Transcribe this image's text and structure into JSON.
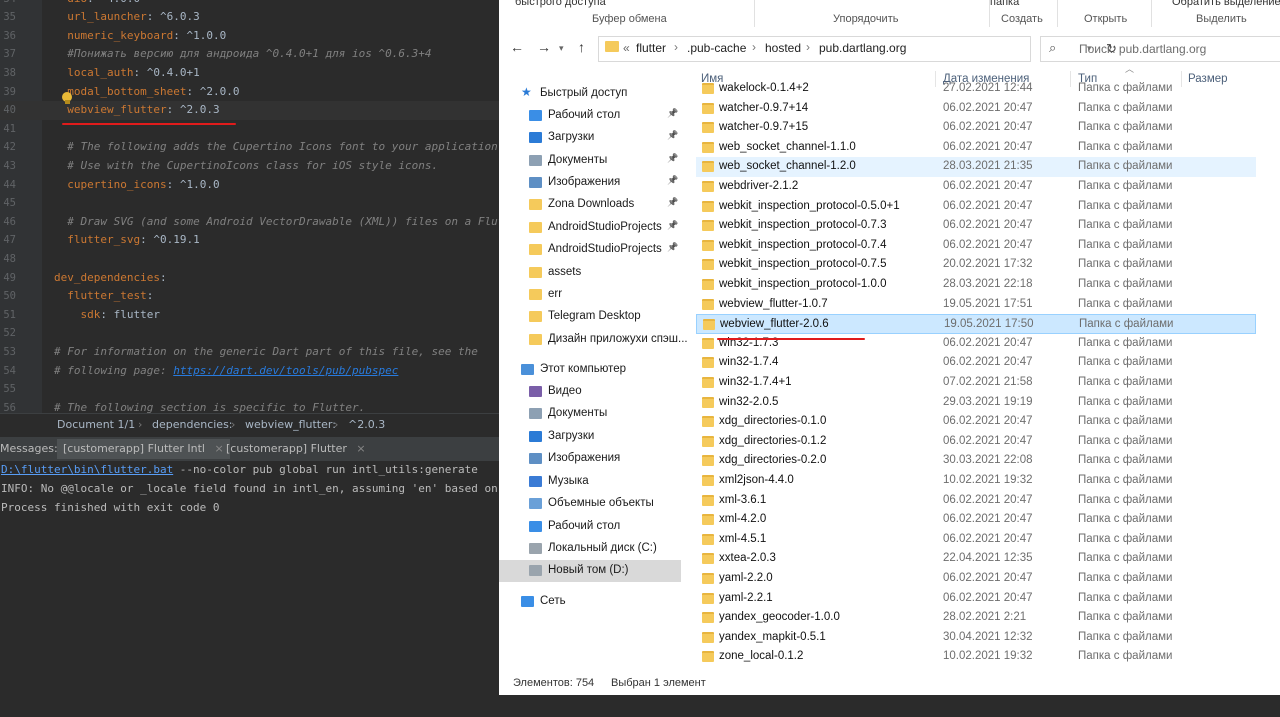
{
  "ide": {
    "editor_lines": [
      {
        "num": "34",
        "key": "dio",
        "val": "^4.0.0",
        "indent": "  "
      },
      {
        "num": "35",
        "key": "url_launcher",
        "val": "^6.0.3",
        "indent": "  "
      },
      {
        "num": "36",
        "key": "numeric_keyboard",
        "val": "^1.0.0",
        "indent": "  "
      },
      {
        "num": "37",
        "comment": "  #Понижать версию для андроида ^0.4.0+1 для ios ^0.6.3+4"
      },
      {
        "num": "38",
        "key": "local_auth",
        "val": "^0.4.0+1",
        "indent": "  "
      },
      {
        "num": "39",
        "key": "modal_bottom_sheet",
        "val": "^2.0.0",
        "indent": "  "
      },
      {
        "num": "40",
        "key": "webview_flutter",
        "val": "^2.0.3",
        "indent": "  "
      },
      {
        "num": "41",
        "comment": ""
      },
      {
        "num": "42",
        "comment": "  # The following adds the Cupertino Icons font to your application."
      },
      {
        "num": "43",
        "comment": "  # Use with the CupertinoIcons class for iOS style icons."
      },
      {
        "num": "44",
        "key": "cupertino_icons",
        "val": "^1.0.0",
        "indent": "  "
      },
      {
        "num": "45",
        "comment": ""
      },
      {
        "num": "46",
        "comment": "  # Draw SVG (and some Android VectorDrawable (XML)) files on a Flut"
      },
      {
        "num": "47",
        "key": "flutter_svg",
        "val": "^0.19.1",
        "indent": "  "
      },
      {
        "num": "48",
        "comment": ""
      },
      {
        "num": "49",
        "key": "dev_dependencies",
        "val": "",
        "indent": ""
      },
      {
        "num": "50",
        "key": "flutter_test",
        "val": "",
        "indent": "  "
      },
      {
        "num": "51",
        "key": "sdk",
        "val": "flutter",
        "indent": "    "
      },
      {
        "num": "52",
        "comment": ""
      },
      {
        "num": "53",
        "comment": "# For information on the generic Dart part of this file, see the"
      },
      {
        "num": "54",
        "comment": "# following page: ",
        "link": "https://dart.dev/tools/pub/pubspec"
      },
      {
        "num": "55",
        "comment": ""
      },
      {
        "num": "56",
        "comment": "# The following section is specific to Flutter."
      }
    ],
    "breadcrumb": {
      "doc": "Document 1/1",
      "sep": "›",
      "dependencies": "dependencies:",
      "webview": "webview_flutter:",
      "version": "^2.0.3"
    },
    "messages": {
      "label": "Messages:",
      "tab1": "[customerapp] Flutter Intl",
      "tab2": "[customerapp] Flutter",
      "close": "×"
    },
    "console": {
      "line1_link": "D:\\flutter\\bin\\flutter.bat",
      "line1_rest": " --no-color pub global run intl_utils:generate",
      "line2": "INFO: No @@locale or _locale field found in intl_en, assuming 'en' based on",
      "line3": "Process finished with exit code 0"
    }
  },
  "explorer": {
    "ribbon": {
      "quick_access": "быстрого доступа",
      "clipboard": "Буфер обмена",
      "organize": "Упорядочить",
      "folder": "папка",
      "create": "Создать",
      "open": "Открыть",
      "select": "Выделить",
      "select_top": "Обратить выделение"
    },
    "address": {
      "back": "←",
      "forward": "→",
      "up": "↑",
      "prefix": "«",
      "segments": [
        "flutter",
        ".pub-cache",
        "hosted",
        "pub.dartlang.org"
      ],
      "refresh": "↻",
      "search_placeholder": "Поиск: pub.dartlang.org"
    },
    "columns": {
      "name": "Имя",
      "date": "Дата изменения",
      "type": "Тип",
      "size": "Размер"
    },
    "nav": [
      {
        "label": "Быстрый доступ",
        "icon": "star-icon",
        "color": "#2b7bd6",
        "indent": 0,
        "pin": false
      },
      {
        "label": "Рабочий стол",
        "icon": "desktop-icon",
        "color": "#3a8ee6",
        "indent": 1,
        "pin": true
      },
      {
        "label": "Загрузки",
        "icon": "download-icon",
        "color": "#2b7bd6",
        "indent": 1,
        "pin": true
      },
      {
        "label": "Документы",
        "icon": "documents-icon",
        "color": "#8da0b3",
        "indent": 1,
        "pin": true
      },
      {
        "label": "Изображения",
        "icon": "pictures-icon",
        "color": "#5e8fc4",
        "indent": 1,
        "pin": true
      },
      {
        "label": "Zona Downloads",
        "icon": "folder-icon",
        "color": "#f5ca5b",
        "indent": 1,
        "pin": true
      },
      {
        "label": "AndroidStudioProjects",
        "icon": "folder-icon",
        "color": "#f5ca5b",
        "indent": 1,
        "pin": true
      },
      {
        "label": "AndroidStudioProjects",
        "icon": "folder-icon",
        "color": "#f5ca5b",
        "indent": 1,
        "pin": true
      },
      {
        "label": "assets",
        "icon": "folder-icon",
        "color": "#f5ca5b",
        "indent": 1,
        "pin": false
      },
      {
        "label": "err",
        "icon": "folder-icon",
        "color": "#f5ca5b",
        "indent": 1,
        "pin": false
      },
      {
        "label": "Telegram Desktop",
        "icon": "folder-icon",
        "color": "#f5ca5b",
        "indent": 1,
        "pin": false
      },
      {
        "label": "Дизайн приложухи спэш...",
        "icon": "folder-icon",
        "color": "#f5ca5b",
        "indent": 1,
        "pin": false
      },
      {
        "label": "Этот компьютер",
        "icon": "computer-icon",
        "color": "#4a90d9",
        "indent": 0,
        "pin": false
      },
      {
        "label": "Видео",
        "icon": "video-icon",
        "color": "#7a5ea8",
        "indent": 1,
        "pin": false
      },
      {
        "label": "Документы",
        "icon": "documents-icon",
        "color": "#8da0b3",
        "indent": 1,
        "pin": false
      },
      {
        "label": "Загрузки",
        "icon": "download-icon",
        "color": "#2b7bd6",
        "indent": 1,
        "pin": false
      },
      {
        "label": "Изображения",
        "icon": "pictures-icon",
        "color": "#5e8fc4",
        "indent": 1,
        "pin": false
      },
      {
        "label": "Музыка",
        "icon": "music-icon",
        "color": "#3a7bd5",
        "indent": 1,
        "pin": false
      },
      {
        "label": "Объемные объекты",
        "icon": "3d-objects-icon",
        "color": "#6aa0d8",
        "indent": 1,
        "pin": false
      },
      {
        "label": "Рабочий стол",
        "icon": "desktop-icon",
        "color": "#3a8ee6",
        "indent": 1,
        "pin": false
      },
      {
        "label": "Локальный диск (C:)",
        "icon": "drive-icon",
        "color": "#9aa4ad",
        "indent": 1,
        "pin": false
      },
      {
        "label": "Новый том (D:)",
        "icon": "drive-icon",
        "color": "#9aa4ad",
        "indent": 1,
        "pin": false,
        "selected": true
      },
      {
        "label": "Сеть",
        "icon": "network-icon",
        "color": "#3a8ee6",
        "indent": 0,
        "pin": false
      }
    ],
    "files": [
      {
        "name": "wakelock-0.1.4+2",
        "date": "27.02.2021 12:44",
        "type": "Папка с файлами"
      },
      {
        "name": "watcher-0.9.7+14",
        "date": "06.02.2021 20:47",
        "type": "Папка с файлами"
      },
      {
        "name": "watcher-0.9.7+15",
        "date": "06.02.2021 20:47",
        "type": "Папка с файлами"
      },
      {
        "name": "web_socket_channel-1.1.0",
        "date": "06.02.2021 20:47",
        "type": "Папка с файлами"
      },
      {
        "name": "web_socket_channel-1.2.0",
        "date": "28.03.2021 21:35",
        "type": "Папка с файлами",
        "state": "hover"
      },
      {
        "name": "webdriver-2.1.2",
        "date": "06.02.2021 20:47",
        "type": "Папка с файлами"
      },
      {
        "name": "webkit_inspection_protocol-0.5.0+1",
        "date": "06.02.2021 20:47",
        "type": "Папка с файлами"
      },
      {
        "name": "webkit_inspection_protocol-0.7.3",
        "date": "06.02.2021 20:47",
        "type": "Папка с файлами"
      },
      {
        "name": "webkit_inspection_protocol-0.7.4",
        "date": "06.02.2021 20:47",
        "type": "Папка с файлами"
      },
      {
        "name": "webkit_inspection_protocol-0.7.5",
        "date": "20.02.2021 17:32",
        "type": "Папка с файлами"
      },
      {
        "name": "webkit_inspection_protocol-1.0.0",
        "date": "28.03.2021 22:18",
        "type": "Папка с файлами"
      },
      {
        "name": "webview_flutter-1.0.7",
        "date": "19.05.2021 17:51",
        "type": "Папка с файлами"
      },
      {
        "name": "webview_flutter-2.0.6",
        "date": "19.05.2021 17:50",
        "type": "Папка с файлами",
        "state": "selected"
      },
      {
        "name": "win32-1.7.3",
        "date": "06.02.2021 20:47",
        "type": "Папка с файлами"
      },
      {
        "name": "win32-1.7.4",
        "date": "06.02.2021 20:47",
        "type": "Папка с файлами"
      },
      {
        "name": "win32-1.7.4+1",
        "date": "07.02.2021 21:58",
        "type": "Папка с файлами"
      },
      {
        "name": "win32-2.0.5",
        "date": "29.03.2021 19:19",
        "type": "Папка с файлами"
      },
      {
        "name": "xdg_directories-0.1.0",
        "date": "06.02.2021 20:47",
        "type": "Папка с файлами"
      },
      {
        "name": "xdg_directories-0.1.2",
        "date": "06.02.2021 20:47",
        "type": "Папка с файлами"
      },
      {
        "name": "xdg_directories-0.2.0",
        "date": "30.03.2021 22:08",
        "type": "Папка с файлами"
      },
      {
        "name": "xml2json-4.4.0",
        "date": "10.02.2021 19:32",
        "type": "Папка с файлами"
      },
      {
        "name": "xml-3.6.1",
        "date": "06.02.2021 20:47",
        "type": "Папка с файлами"
      },
      {
        "name": "xml-4.2.0",
        "date": "06.02.2021 20:47",
        "type": "Папка с файлами"
      },
      {
        "name": "xml-4.5.1",
        "date": "06.02.2021 20:47",
        "type": "Папка с файлами"
      },
      {
        "name": "xxtea-2.0.3",
        "date": "22.04.2021 12:35",
        "type": "Папка с файлами"
      },
      {
        "name": "yaml-2.2.0",
        "date": "06.02.2021 20:47",
        "type": "Папка с файлами"
      },
      {
        "name": "yaml-2.2.1",
        "date": "06.02.2021 20:47",
        "type": "Папка с файлами"
      },
      {
        "name": "yandex_geocoder-1.0.0",
        "date": "28.02.2021 2:21",
        "type": "Папка с файлами"
      },
      {
        "name": "yandex_mapkit-0.5.1",
        "date": "30.04.2021 12:32",
        "type": "Папка с файлами"
      },
      {
        "name": "zone_local-0.1.2",
        "date": "10.02.2021 19:32",
        "type": "Папка с файлами"
      }
    ],
    "status": {
      "count": "Элементов: 754",
      "selected": "Выбран 1 элемент"
    }
  },
  "colors": {
    "annotation_red": "#e01b1b",
    "selection_blue": "#cce8ff",
    "folder_yellow": "#f5ca5b"
  }
}
